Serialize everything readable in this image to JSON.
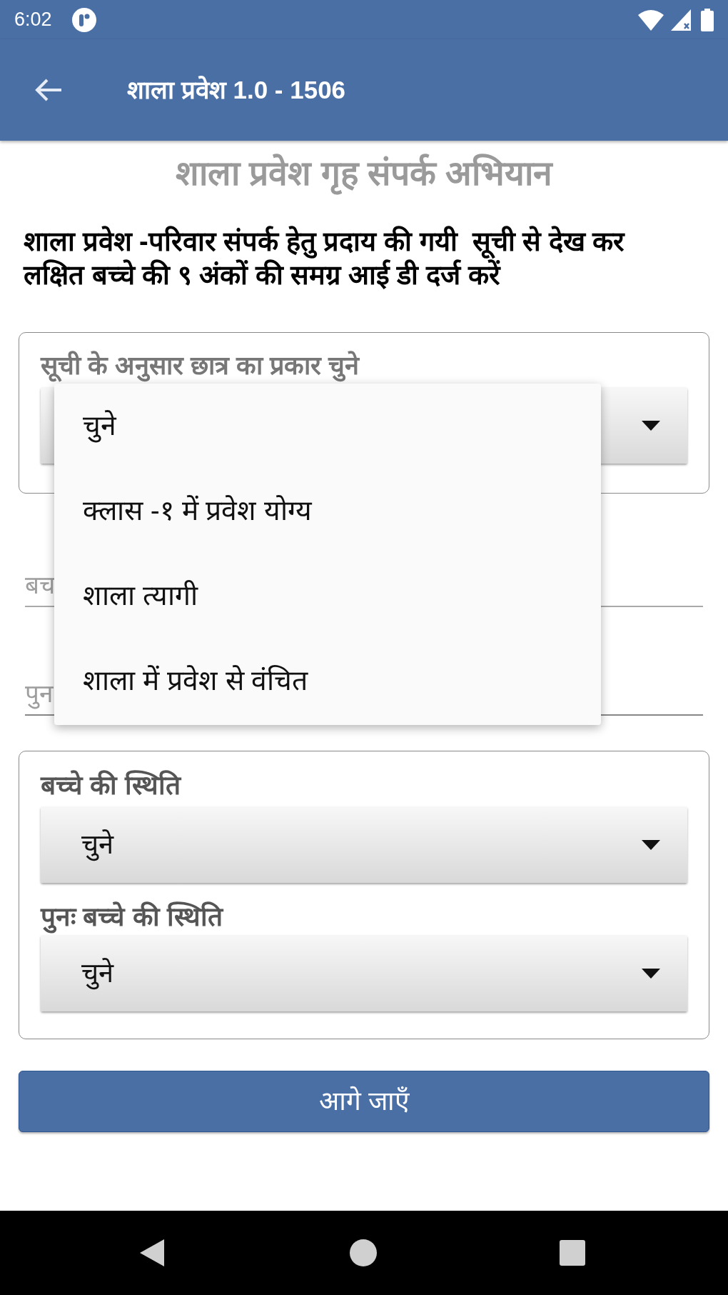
{
  "status_bar": {
    "time": "6:02"
  },
  "app_bar": {
    "title": "शाला प्रवेश 1.0 - 1506"
  },
  "heading": "शाला प्रवेश गृह संपर्क अभियान",
  "instruction_lines": [
    "शाला प्रवेश -परिवार संपर्क हेतु प्रदाय की गयी  सूची से देख कर",
    "लक्षित बच्चे की ९ अंकों की समग्र आई डी दर्ज करें"
  ],
  "student_type": {
    "label": "सूची के अनुसार छात्र का प्रकार चुने",
    "expanded": true,
    "options": [
      {
        "label": "चुने"
      },
      {
        "label": "क्लास -१ में प्रवेश योग्य"
      },
      {
        "label": "शाला त्यागी"
      },
      {
        "label": "शाला में प्रवेश से वंचित"
      }
    ]
  },
  "fields": [
    {
      "placeholder": "बच"
    },
    {
      "placeholder": "पुन"
    }
  ],
  "child_status": [
    {
      "label": "बच्चे की स्थिति",
      "value": "चुने"
    },
    {
      "label": "पुनः बच्चे की स्थिति",
      "value": "चुने"
    }
  ],
  "next_button": "आगे जाएँ"
}
